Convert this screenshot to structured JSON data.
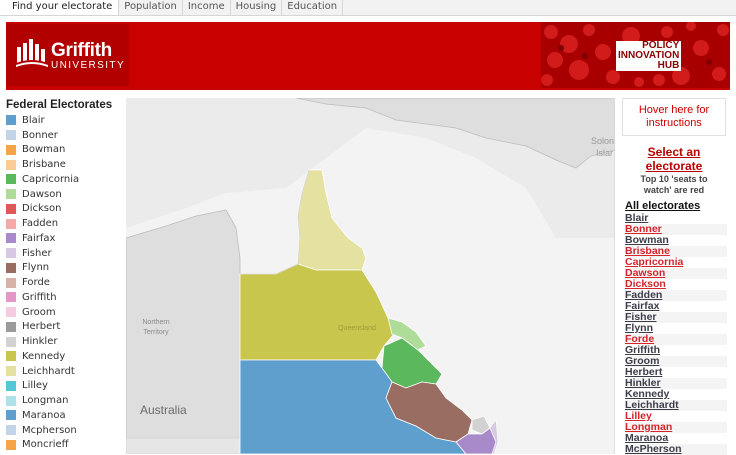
{
  "tabs": [
    "Find your electorate",
    "Population",
    "Income",
    "Housing",
    "Education"
  ],
  "banner": {
    "logo_main": "Griffith",
    "logo_sub": "UNIVERSITY",
    "hub_lines": [
      "POLICY",
      "INNOVATION",
      "HUB"
    ],
    "brand_color": "#c80000"
  },
  "legend": {
    "title": "Federal Electorates",
    "items": [
      {
        "label": "Blair",
        "color": "#5f9fce"
      },
      {
        "label": "Bonner",
        "color": "#c2d4e8"
      },
      {
        "label": "Bowman",
        "color": "#f7a449"
      },
      {
        "label": "Brisbane",
        "color": "#fbcc96"
      },
      {
        "label": "Capricornia",
        "color": "#5cb85c"
      },
      {
        "label": "Dawson",
        "color": "#b0dc9a"
      },
      {
        "label": "Dickson",
        "color": "#e05757"
      },
      {
        "label": "Fadden",
        "color": "#f5a9a9"
      },
      {
        "label": "Fairfax",
        "color": "#a889c9"
      },
      {
        "label": "Fisher",
        "color": "#d7c9e3"
      },
      {
        "label": "Flynn",
        "color": "#9a6d62"
      },
      {
        "label": "Forde",
        "color": "#d8b1a8"
      },
      {
        "label": "Griffith",
        "color": "#e597c8"
      },
      {
        "label": "Groom",
        "color": "#f6cbe0"
      },
      {
        "label": "Herbert",
        "color": "#9b9b9b"
      },
      {
        "label": "Hinkler",
        "color": "#d2d2d2"
      },
      {
        "label": "Kennedy",
        "color": "#c9c64e"
      },
      {
        "label": "Leichhardt",
        "color": "#e4e1a1"
      },
      {
        "label": "Lilley",
        "color": "#52c7d6"
      },
      {
        "label": "Longman",
        "color": "#aee1e8"
      },
      {
        "label": "Maranoa",
        "color": "#5f9fce"
      },
      {
        "label": "Mcpherson",
        "color": "#c2d4e8"
      },
      {
        "label": "Moncrieff",
        "color": "#f7a449"
      }
    ]
  },
  "map": {
    "label_australia": "Australia",
    "label_nt": [
      "Northern",
      "Territory"
    ],
    "label_qld": "Queensland",
    "label_solomon": [
      "Solon",
      "Islar"
    ]
  },
  "panel": {
    "hover_text": [
      "Hover here for",
      "instructions"
    ],
    "select_title": [
      "Select an",
      "electorate"
    ],
    "select_sub": [
      "Top 10 'seats to",
      "watch' are red"
    ],
    "all_title": "All electorates",
    "electorates": [
      {
        "name": "Blair",
        "red": false
      },
      {
        "name": "Bonner",
        "red": true
      },
      {
        "name": "Bowman",
        "red": false
      },
      {
        "name": "Brisbane",
        "red": true
      },
      {
        "name": "Capricornia",
        "red": true
      },
      {
        "name": "Dawson",
        "red": true
      },
      {
        "name": "Dickson",
        "red": true
      },
      {
        "name": "Fadden",
        "red": false
      },
      {
        "name": "Fairfax",
        "red": false
      },
      {
        "name": "Fisher",
        "red": false
      },
      {
        "name": "Flynn",
        "red": false
      },
      {
        "name": "Forde",
        "red": true
      },
      {
        "name": "Griffith",
        "red": false
      },
      {
        "name": "Groom",
        "red": false
      },
      {
        "name": "Herbert",
        "red": false
      },
      {
        "name": "Hinkler",
        "red": false
      },
      {
        "name": "Kennedy",
        "red": false
      },
      {
        "name": "Leichhardt",
        "red": false
      },
      {
        "name": "Lilley",
        "red": true
      },
      {
        "name": "Longman",
        "red": true
      },
      {
        "name": "Maranoa",
        "red": false
      },
      {
        "name": "McPherson",
        "red": false
      }
    ]
  }
}
